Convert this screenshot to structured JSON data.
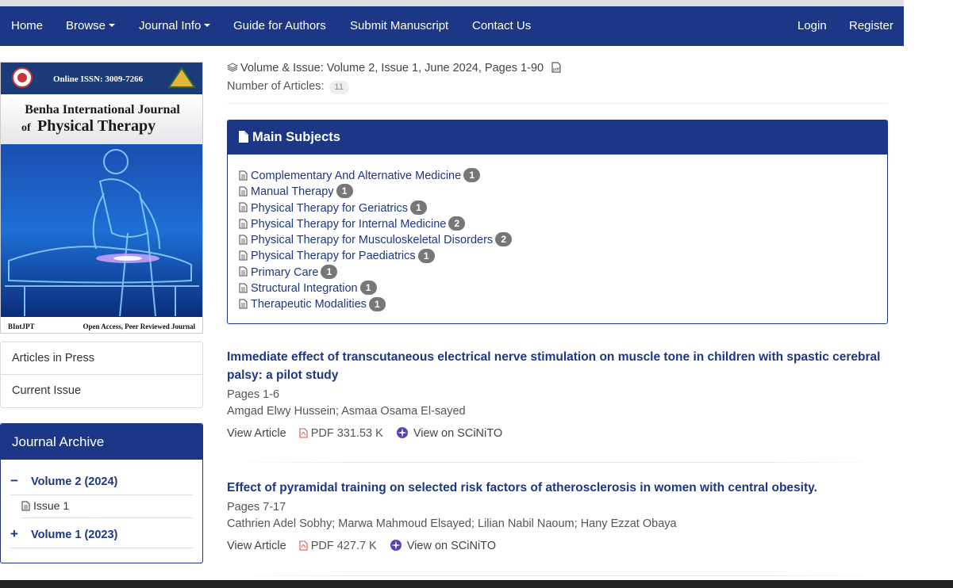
{
  "nav": {
    "home": "Home",
    "browse": "Browse",
    "journal_info": "Journal Info",
    "guide": "Guide for Authors",
    "submit": "Submit Manuscript",
    "contact": "Contact Us",
    "login": "Login",
    "register": "Register"
  },
  "cover": {
    "issn": "Online ISSN: 3009-7266",
    "title_line1": "Benha International Journal",
    "title_line2_prefix": "of",
    "title_line2_main": "Physical Therapy",
    "footer_left": "BIntJPT",
    "footer_right": "Open Access, Peer Reviewed Journal"
  },
  "sidebar": {
    "links": [
      "Articles in Press",
      "Current Issue"
    ],
    "archive_title": "Journal Archive",
    "volumes": [
      {
        "label": "Volume 2 (2024)",
        "sign": "−"
      },
      {
        "label": "Volume 1 (2023)",
        "sign": "+"
      }
    ],
    "issue": "Issue 1"
  },
  "issue_info": {
    "volume_text": "Volume & Issue: Volume 2, Issue 1, June 2024, Pages 1-90",
    "num_label": "Number of Articles:",
    "num_value": "11"
  },
  "subjects": {
    "title": "Main Subjects",
    "items": [
      {
        "label": "Complementary And Alternative Medicine",
        "count": "1"
      },
      {
        "label": "Manual Therapy",
        "count": "1"
      },
      {
        "label": "Physical Therapy for Geriatrics",
        "count": "1"
      },
      {
        "label": "Physical Therapy for Internal Medicine",
        "count": "2"
      },
      {
        "label": "Physical Therapy for Musculoskeletal Disorders",
        "count": "2"
      },
      {
        "label": "Physical Therapy for Paediatrics",
        "count": "1"
      },
      {
        "label": "Primary Care",
        "count": "1"
      },
      {
        "label": "Structural Integration",
        "count": "1"
      },
      {
        "label": "Therapeutic Modalities",
        "count": "1"
      }
    ]
  },
  "articles": [
    {
      "title": "Immediate effect of transcutaneous electrical nerve stimulation on muscle tone in children with spastic cerebral palsy: a pilot study",
      "pages": "Pages 1-6",
      "authors": "Amgad Elwy Hussein; Asmaa Osama El-sayed",
      "view": "View Article",
      "pdf": "PDF 331.53 K",
      "scinito": "View on SCiNiTO"
    },
    {
      "title": "Effect of pyramidal training on selected risk factors of atherosclerosis in women with central obesity.",
      "pages": "Pages 7-17",
      "authors": "Cathrien Adel Sobhy; Marwa Mahmoud Elsayed; Lilian Nabil Naoum; Hany Ezzat Obaya",
      "view": "View Article",
      "pdf": "PDF 427.7 K",
      "scinito": "View on SCiNiTO"
    }
  ],
  "colors": {
    "primary": "#1c3785",
    "badge": "#777777",
    "pdf_icon": "#d9534f",
    "scinito_icon": "#5b3fb5"
  }
}
